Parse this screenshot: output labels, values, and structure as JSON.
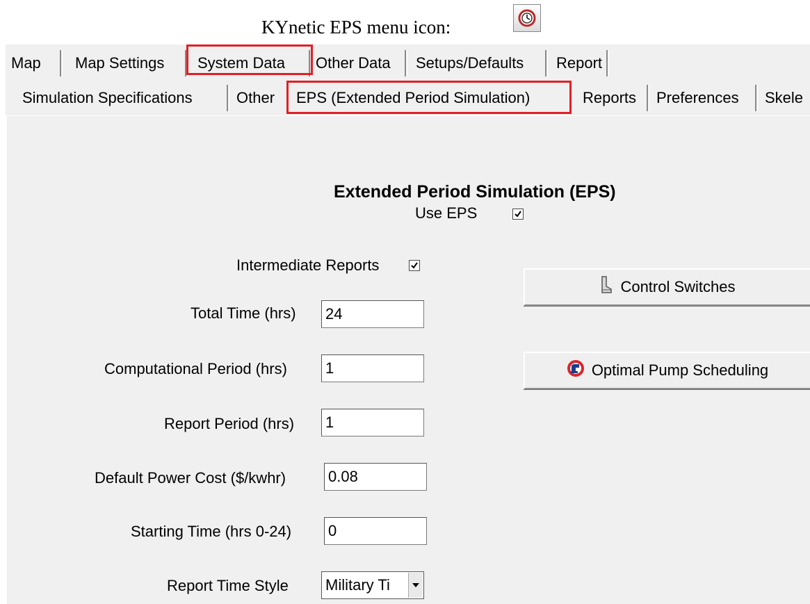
{
  "caption": {
    "text": "KYnetic EPS menu icon:",
    "icon": "clock-icon"
  },
  "tabs_row1": [
    "Map",
    "Map Settings",
    "System Data",
    "Other Data",
    "Setups/Defaults",
    "Report"
  ],
  "tabs_row2": [
    "Simulation Specifications",
    "Other",
    "EPS  (Extended Period Simulation)",
    "Reports",
    "Preferences",
    "Skele"
  ],
  "highlight_color": "#e21f26",
  "heading": "Extended Period Simulation (EPS)",
  "use_eps": {
    "label": "Use EPS",
    "checked": true
  },
  "intermediate_reports": {
    "label": "Intermediate Reports",
    "checked": true
  },
  "fields": {
    "total_time": {
      "label": "Total Time (hrs)",
      "value": "24"
    },
    "computational_period": {
      "label": "Computational Period (hrs)",
      "value": "1"
    },
    "report_period": {
      "label": "Report Period (hrs)",
      "value": "1"
    },
    "power_cost": {
      "label": "Default Power Cost ($/kwhr)",
      "value": "0.08"
    },
    "starting_time": {
      "label": "Starting Time (hrs 0-24)",
      "value": "0"
    },
    "report_time_style": {
      "label": "Report Time Style",
      "value": "Military Ti"
    }
  },
  "buttons": {
    "control_switches": {
      "label": "Control Switches",
      "icon": "boot-icon"
    },
    "optimal_pump": {
      "label": "Optimal Pump Scheduling",
      "icon": "pump-icon"
    }
  }
}
